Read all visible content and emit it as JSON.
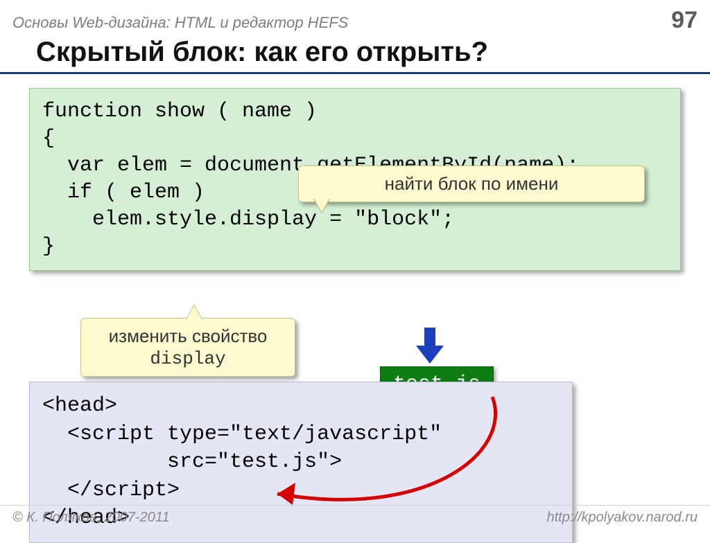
{
  "header": {
    "subject": "Основы Web-дизайна: HTML и редактор HEFS",
    "page_number": "97"
  },
  "title": "Скрытый блок: как его открыть?",
  "code_green": "function show ( name )\n{\n  var elem = document.getElementById(name);\n  if ( elem )\n    elem.style.display = \"block\";\n}",
  "callout_find": "найти блок по имени",
  "callout_display_line1": "изменить свойство",
  "callout_display_line2": "display",
  "file_label": "test.js",
  "code_blue": "<head>\n  <script type=\"text/javascript\"\n          src=\"test.js\">\n  </script>\n</head>",
  "footer": {
    "copyright": "© К. Поляков, 2007-2011",
    "url": "http://kpolyakov.narod.ru"
  }
}
